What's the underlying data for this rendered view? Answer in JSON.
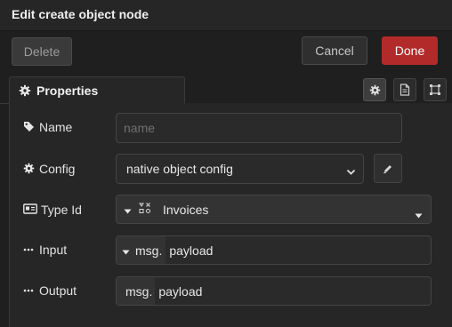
{
  "dialog": {
    "title": "Edit create object node",
    "delete_label": "Delete",
    "cancel_label": "Cancel",
    "done_label": "Done",
    "done_color": "#b22a2a"
  },
  "tabs": {
    "properties_label": "Properties",
    "properties_icon": "gear-icon",
    "icon_tabs": [
      "gear-icon",
      "document-icon",
      "frame-icon"
    ]
  },
  "form": {
    "name": {
      "label": "Name",
      "icon": "tag-icon",
      "value": "",
      "placeholder": "name"
    },
    "config": {
      "label": "Config",
      "icon": "gear-icon",
      "value": "native object config",
      "edit_icon": "pencil-icon"
    },
    "type_id": {
      "label": "Type Id",
      "icon": "id-card-icon",
      "value": "Invoices",
      "type_icon": "object-type-icon"
    },
    "input": {
      "label": "Input",
      "icon": "ellipsis-icon",
      "prefix": "msg.",
      "value": "payload"
    },
    "output": {
      "label": "Output",
      "icon": "ellipsis-icon",
      "prefix": "msg.",
      "value": "payload"
    }
  }
}
